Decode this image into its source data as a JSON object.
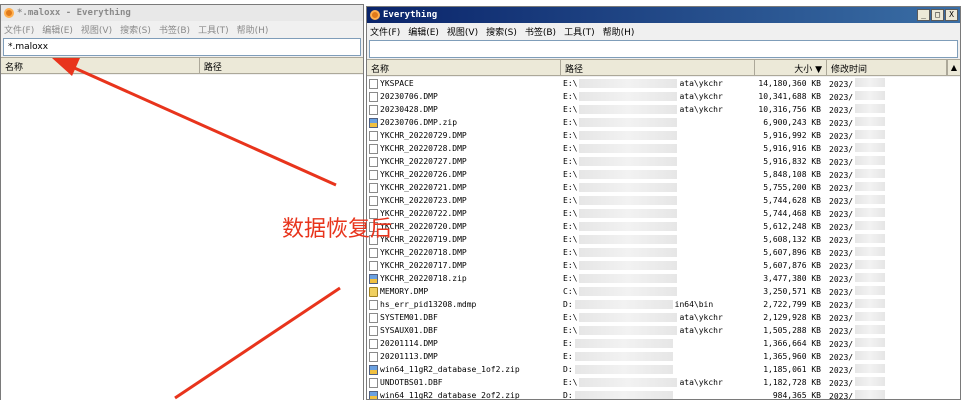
{
  "annotation": {
    "text": "数据恢复后",
    "color": "#e8341c"
  },
  "left_window": {
    "title": "*.maloxx - Everything",
    "menu": [
      "文件(F)",
      "编辑(E)",
      "视图(V)",
      "搜索(S)",
      "书签(B)",
      "工具(T)",
      "帮助(H)"
    ],
    "search_value": "*.maloxx",
    "columns": {
      "name": "名称",
      "path": "路径"
    }
  },
  "right_window": {
    "title": "Everything",
    "controls": {
      "minimize": "_",
      "maximize": "□",
      "close": "X"
    },
    "menu": [
      "文件(F)",
      "编辑(E)",
      "视图(V)",
      "搜索(S)",
      "书签(B)",
      "工具(T)",
      "帮助(H)"
    ],
    "search_value": "",
    "columns": {
      "name": "名称",
      "path": "路径",
      "size": "大小 ▼",
      "date": "修改时间"
    },
    "rows": [
      {
        "icon": "file-icon",
        "name": "YKSPACE",
        "path_prefix": "E:\\",
        "path_suffix": "ata\\ykchr",
        "size": "14,180,360 KB",
        "date": "2023/"
      },
      {
        "icon": "file-icon",
        "name": "20230706.DMP",
        "path_prefix": "E:\\",
        "path_suffix": "ata\\ykchr",
        "size": "10,341,688 KB",
        "date": "2023/"
      },
      {
        "icon": "file-icon",
        "name": "20230428.DMP",
        "path_prefix": "E:\\",
        "path_suffix": "ata\\ykchr",
        "size": "10,316,756 KB",
        "date": "2023/"
      },
      {
        "icon": "zip-icon",
        "name": "20230706.DMP.zip",
        "path_prefix": "E:\\",
        "path_suffix": "",
        "size": "6,900,243 KB",
        "date": "2023/"
      },
      {
        "icon": "file-icon",
        "name": "YKCHR_20220729.DMP",
        "path_prefix": "E:\\",
        "path_suffix": "",
        "size": "5,916,992 KB",
        "date": "2023/"
      },
      {
        "icon": "file-icon",
        "name": "YKCHR_20220728.DMP",
        "path_prefix": "E:\\",
        "path_suffix": "",
        "size": "5,916,916 KB",
        "date": "2023/"
      },
      {
        "icon": "file-icon",
        "name": "YKCHR_20220727.DMP",
        "path_prefix": "E:\\",
        "path_suffix": "",
        "size": "5,916,832 KB",
        "date": "2023/"
      },
      {
        "icon": "file-icon",
        "name": "YKCHR_20220726.DMP",
        "path_prefix": "E:\\",
        "path_suffix": "",
        "size": "5,848,108 KB",
        "date": "2023/"
      },
      {
        "icon": "file-icon",
        "name": "YKCHR_20220721.DMP",
        "path_prefix": "E:\\",
        "path_suffix": "",
        "size": "5,755,200 KB",
        "date": "2023/"
      },
      {
        "icon": "file-icon",
        "name": "YKCHR_20220723.DMP",
        "path_prefix": "E:\\",
        "path_suffix": "",
        "size": "5,744,628 KB",
        "date": "2023/"
      },
      {
        "icon": "file-icon",
        "name": "YKCHR_20220722.DMP",
        "path_prefix": "E:\\",
        "path_suffix": "",
        "size": "5,744,468 KB",
        "date": "2023/"
      },
      {
        "icon": "file-icon",
        "name": "YKCHR_20220720.DMP",
        "path_prefix": "E:\\",
        "path_suffix": "",
        "size": "5,612,248 KB",
        "date": "2023/"
      },
      {
        "icon": "file-icon",
        "name": "YKCHR_20220719.DMP",
        "path_prefix": "E:\\",
        "path_suffix": "",
        "size": "5,608,132 KB",
        "date": "2023/"
      },
      {
        "icon": "file-icon",
        "name": "YKCHR_20220718.DMP",
        "path_prefix": "E:\\",
        "path_suffix": "",
        "size": "5,607,896 KB",
        "date": "2023/"
      },
      {
        "icon": "file-icon",
        "name": "YKCHR_20220717.DMP",
        "path_prefix": "E:\\",
        "path_suffix": "",
        "size": "5,607,876 KB",
        "date": "2023/"
      },
      {
        "icon": "zip-icon",
        "name": "YKCHR_20220718.zip",
        "path_prefix": "E:\\",
        "path_suffix": "",
        "size": "3,477,380 KB",
        "date": "2023/"
      },
      {
        "icon": "warning-file-icon",
        "name": "MEMORY.DMP",
        "path_prefix": "C:\\",
        "path_suffix": "",
        "size": "3,250,571 KB",
        "date": "2023/"
      },
      {
        "icon": "file-icon",
        "name": "hs_err_pid13208.mdmp",
        "path_prefix": "D:",
        "path_suffix": "in64\\bin",
        "size": "2,722,799 KB",
        "date": "2023/"
      },
      {
        "icon": "file-icon",
        "name": "SYSTEM01.DBF",
        "path_prefix": "E:\\",
        "path_suffix": "ata\\ykchr",
        "size": "2,129,928 KB",
        "date": "2023/"
      },
      {
        "icon": "file-icon",
        "name": "SYSAUX01.DBF",
        "path_prefix": "E:\\",
        "path_suffix": "ata\\ykchr",
        "size": "1,505,288 KB",
        "date": "2023/"
      },
      {
        "icon": "file-icon",
        "name": "20201114.DMP",
        "path_prefix": "E:",
        "path_suffix": "",
        "size": "1,366,664 KB",
        "date": "2023/"
      },
      {
        "icon": "file-icon",
        "name": "20201113.DMP",
        "path_prefix": "E:",
        "path_suffix": "",
        "size": "1,365,960 KB",
        "date": "2023/"
      },
      {
        "icon": "zip-icon",
        "name": "win64_11gR2_database_1of2.zip",
        "path_prefix": "D:",
        "path_suffix": "",
        "size": "1,185,061 KB",
        "date": "2023/"
      },
      {
        "icon": "file-icon",
        "name": "UNDOTBS01.DBF",
        "path_prefix": "E:\\",
        "path_suffix": "ata\\ykchr",
        "size": "1,182,728 KB",
        "date": "2023/"
      },
      {
        "icon": "zip-icon",
        "name": "win64_11gR2_database_2of2.zip",
        "path_prefix": "D:",
        "path_suffix": "",
        "size": "984,365 KB",
        "date": "2023/"
      }
    ]
  }
}
